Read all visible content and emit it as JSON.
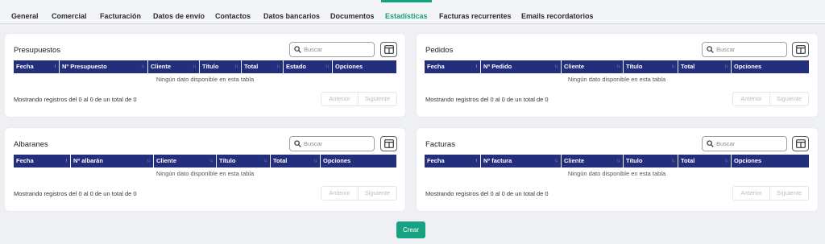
{
  "tabs": [
    {
      "label": "General"
    },
    {
      "label": "Comercial"
    },
    {
      "label": "Facturación"
    },
    {
      "label": "Datos de envío"
    },
    {
      "label": "Contactos"
    },
    {
      "label": "Datos bancarios"
    },
    {
      "label": "Documentos"
    },
    {
      "label": "Estadísticas",
      "active": true
    },
    {
      "label": "Facturas recurrentes"
    },
    {
      "label": "Emails recordatorios"
    }
  ],
  "accent_color": "#16a37f",
  "header_color": "#232e7c",
  "common": {
    "search_placeholder": "Buscar",
    "empty_text": "Ningún dato disponible en esta tabla",
    "info_text": "Mostrando registros del 0 al 0 de un total de 0",
    "prev_label": "Anterior",
    "next_label": "Siguiente",
    "column_toggle_icon": "columns-icon",
    "search_icon": "search-icon"
  },
  "presupuestos": {
    "title": "Presupuestos",
    "columns": [
      "Fecha",
      "Nº Presupuesto",
      "Cliente",
      "Título",
      "Total",
      "Estado",
      "Opciones"
    ]
  },
  "pedidos": {
    "title": "Pedidos",
    "columns": [
      "Fecha",
      "Nº Pedido",
      "Cliente",
      "Título",
      "Total",
      "Opciones"
    ]
  },
  "albaranes": {
    "title": "Albaranes",
    "columns": [
      "Fecha",
      "Nº albarán",
      "Cliente",
      "Título",
      "Total",
      "Opciones"
    ]
  },
  "facturas": {
    "title": "Facturas",
    "columns": [
      "Fecha",
      "Nº factura",
      "Cliente",
      "Título",
      "Total",
      "Opciones"
    ]
  },
  "crear_label": "Crear"
}
